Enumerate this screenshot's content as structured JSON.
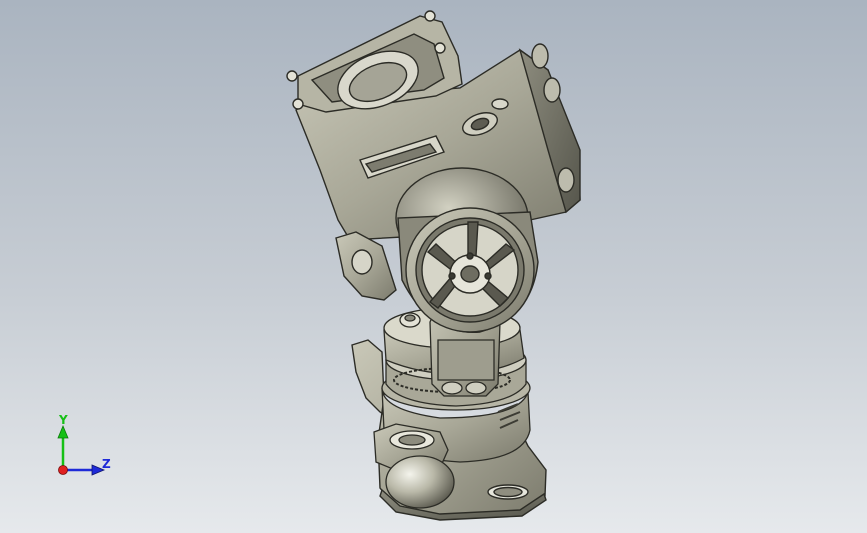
{
  "viewport": {
    "background_top": "#aab4c0",
    "background_bottom": "#e6e9ec"
  },
  "model": {
    "icon": "gimbal-camera-assembly-icon"
  },
  "triad": {
    "y_label": "Y",
    "z_label": "Z",
    "y_color": "#16c016",
    "z_color": "#1e2ad8",
    "x_color": "#e02020"
  }
}
